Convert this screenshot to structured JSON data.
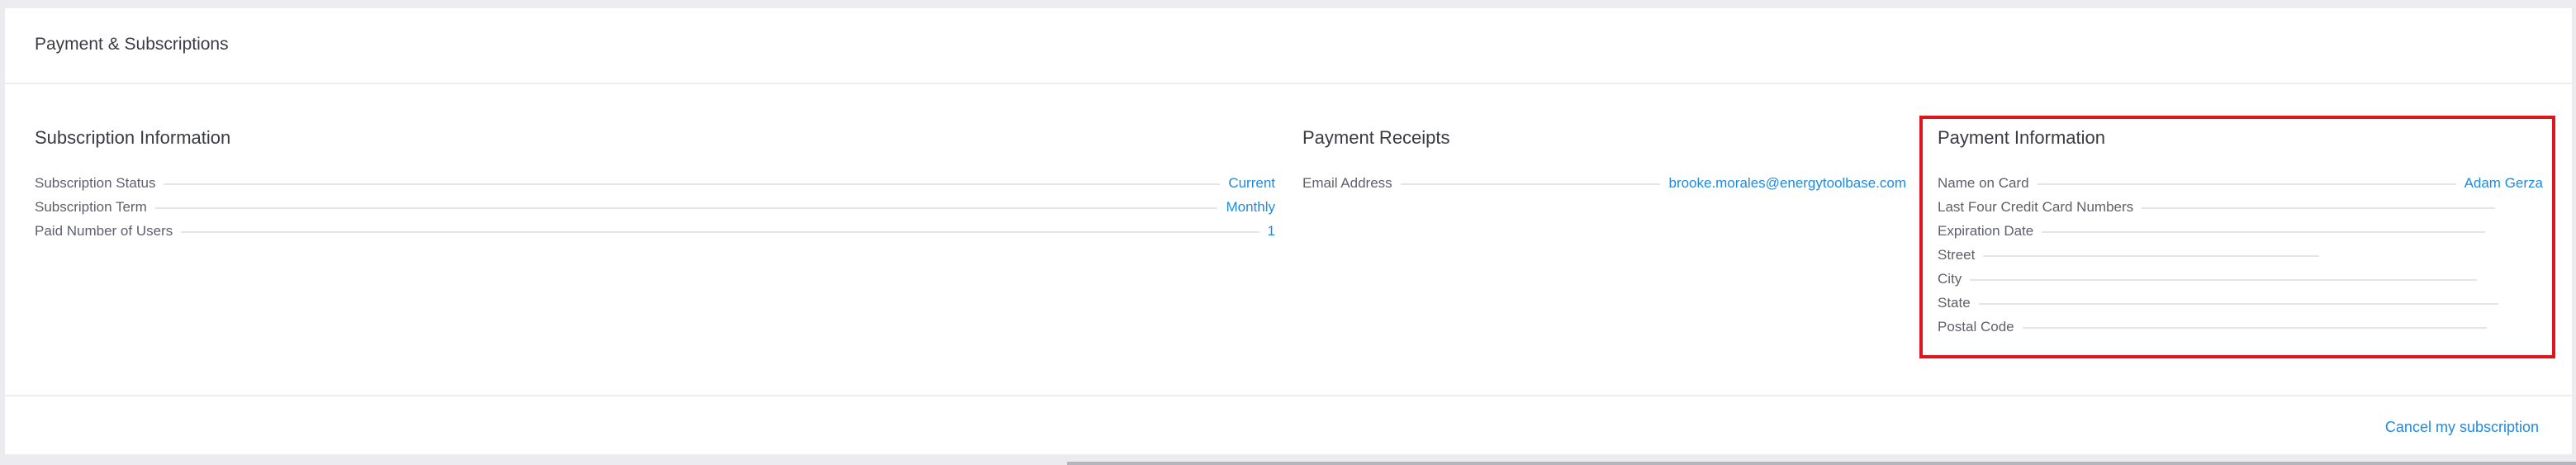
{
  "card": {
    "title": "Payment & Subscriptions"
  },
  "subscription": {
    "heading": "Subscription Information",
    "rows": [
      {
        "label": "Subscription Status",
        "value": "Current"
      },
      {
        "label": "Subscription Term",
        "value": "Monthly"
      },
      {
        "label": "Paid Number of Users",
        "value": "1"
      }
    ]
  },
  "receipts": {
    "heading": "Payment Receipts",
    "rows": [
      {
        "label": "Email Address",
        "value": "brooke.morales@energytoolbase.com"
      }
    ]
  },
  "payment": {
    "heading": "Payment Information",
    "rows": [
      {
        "label": "Name on Card",
        "value": "Adam Gerza"
      },
      {
        "label": "Last Four Credit Card Numbers",
        "value": ""
      },
      {
        "label": "Expiration Date",
        "value": ""
      },
      {
        "label": "Street",
        "value": ""
      },
      {
        "label": "City",
        "value": ""
      },
      {
        "label": "State",
        "value": ""
      },
      {
        "label": "Postal Code",
        "value": ""
      }
    ]
  },
  "footer": {
    "cancel_label": "Cancel my subscription"
  },
  "colors": {
    "accent": "#1f8ae0",
    "highlight_border": "#e0141c"
  }
}
